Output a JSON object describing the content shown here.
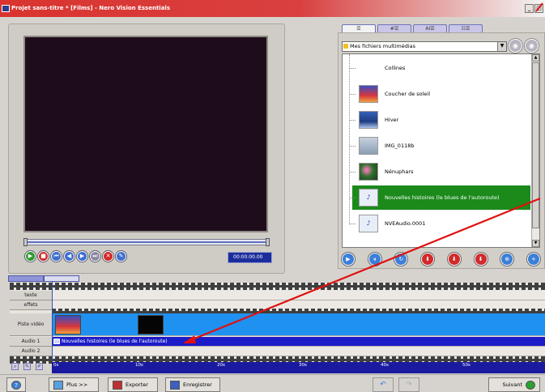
{
  "window": {
    "title": "Projet sans-titre * [Films] - Nero Vision Essentials",
    "minimize_glyph": "_",
    "maximize_glyph": "□"
  },
  "preview": {
    "timecode": "00:00:00.00",
    "transport_glyphs": {
      "play": "▶",
      "stop": "■",
      "prev": "⏮",
      "rew": "◀",
      "fwd": "▶",
      "next": "⏭",
      "delete": "✕",
      "edit": "✎"
    }
  },
  "browser": {
    "tabs": [
      "☰",
      "#☰",
      "AI☰",
      "☷☰"
    ],
    "source": "Mes fichiers multimédias",
    "items": [
      {
        "label": "Collines",
        "thumb": "collines"
      },
      {
        "label": "Coucher de soleil",
        "thumb": "sunset"
      },
      {
        "label": "Hiver",
        "thumb": "winter"
      },
      {
        "label": "IMG_0118b",
        "thumb": "img"
      },
      {
        "label": "Nénuphars",
        "thumb": "lilies"
      },
      {
        "label": "Nouvelles histoires (le blues de l'autoroute)",
        "thumb": "audio",
        "selected": true
      },
      {
        "label": "NVEAudio.0001",
        "thumb": "audio"
      }
    ],
    "tool_glyphs": [
      "▶",
      "⏸",
      "↻",
      "⬇",
      "⬇",
      "⬇",
      "⊕",
      "+"
    ]
  },
  "timeline": {
    "tracks": [
      "texte",
      "effets",
      "Piste vidéo",
      "Audio 1",
      "Audio 2"
    ],
    "audio_clip": "Nouvelles histoires (le blues de l'autoroute)",
    "ruler_ticks": [
      "0s",
      "10s",
      "20s",
      "30s",
      "40s",
      "50s"
    ]
  },
  "bottom": {
    "more": "Plus >>",
    "export": "Exporter",
    "save": "Enregistrer",
    "next": "Suivant",
    "help_glyph": "?",
    "undo_glyph": "↶",
    "redo_glyph": "↷"
  },
  "colors": {
    "accent": "#1b1bc8",
    "video_track": "#1f91f0",
    "selected_item": "#1b8a1b",
    "annotation_arrow": "#e01010"
  }
}
